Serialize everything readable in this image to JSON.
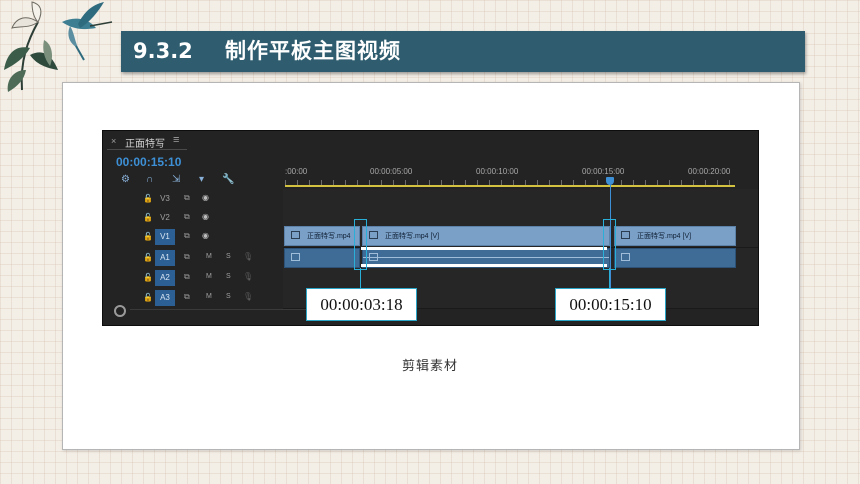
{
  "header": {
    "section_number": "9.3.2",
    "section_title": "制作平板主图视频"
  },
  "panel": {
    "close_symbol": "×",
    "sequence_name": "正面特写",
    "menu_symbol": "≡",
    "timecode": "00:00:15:10",
    "toolbar": [
      {
        "name": "snap-icon",
        "glyph": "⚙"
      },
      {
        "name": "linked-selection-icon",
        "glyph": "∩"
      },
      {
        "name": "add-marker-icon",
        "glyph": "⇲"
      },
      {
        "name": "marker-icon",
        "glyph": "▾"
      },
      {
        "name": "wrench-icon",
        "glyph": "🔧"
      }
    ],
    "ruler_labels": [
      ":00:00",
      "00:00:05:00",
      "00:00:10:00",
      "00:00:15:00",
      "00:00:20:00"
    ],
    "video_tracks": [
      {
        "name": "V3",
        "target": false,
        "lock": "🔓",
        "film": "⧉",
        "eye": "◉"
      },
      {
        "name": "V2",
        "target": false,
        "lock": "🔓",
        "film": "⧉",
        "eye": "◉"
      },
      {
        "name": "V1",
        "target": true,
        "lock": "🔓",
        "film": "⧉",
        "eye": "◉"
      }
    ],
    "audio_tracks": [
      {
        "name": "A1",
        "target": true,
        "lock": "🔓",
        "film": "⧉",
        "m": "M",
        "s": "S",
        "mic": "🎙"
      },
      {
        "name": "A2",
        "target": true,
        "lock": "🔓",
        "film": "⧉",
        "m": "M",
        "s": "S",
        "mic": "🎙"
      },
      {
        "name": "A3",
        "target": true,
        "lock": "🔓",
        "film": "⧉",
        "m": "M",
        "s": "S",
        "mic": "🎙"
      }
    ],
    "clips": {
      "v1_a": "正面特写.mp4",
      "v1_b": "正面特写.mp4 [V]",
      "v1_c": "正面特写.mp4 [V]"
    }
  },
  "callouts": {
    "left": "00:00:03:18",
    "right": "00:00:15:10"
  },
  "caption": "剪辑素材",
  "colors": {
    "title_bar": "#2f5d6f",
    "timecode": "#3d90d6",
    "highlight": "#2ab0d8",
    "clip_video": "#7aa0c8",
    "clip_audio": "#3f6c97"
  }
}
